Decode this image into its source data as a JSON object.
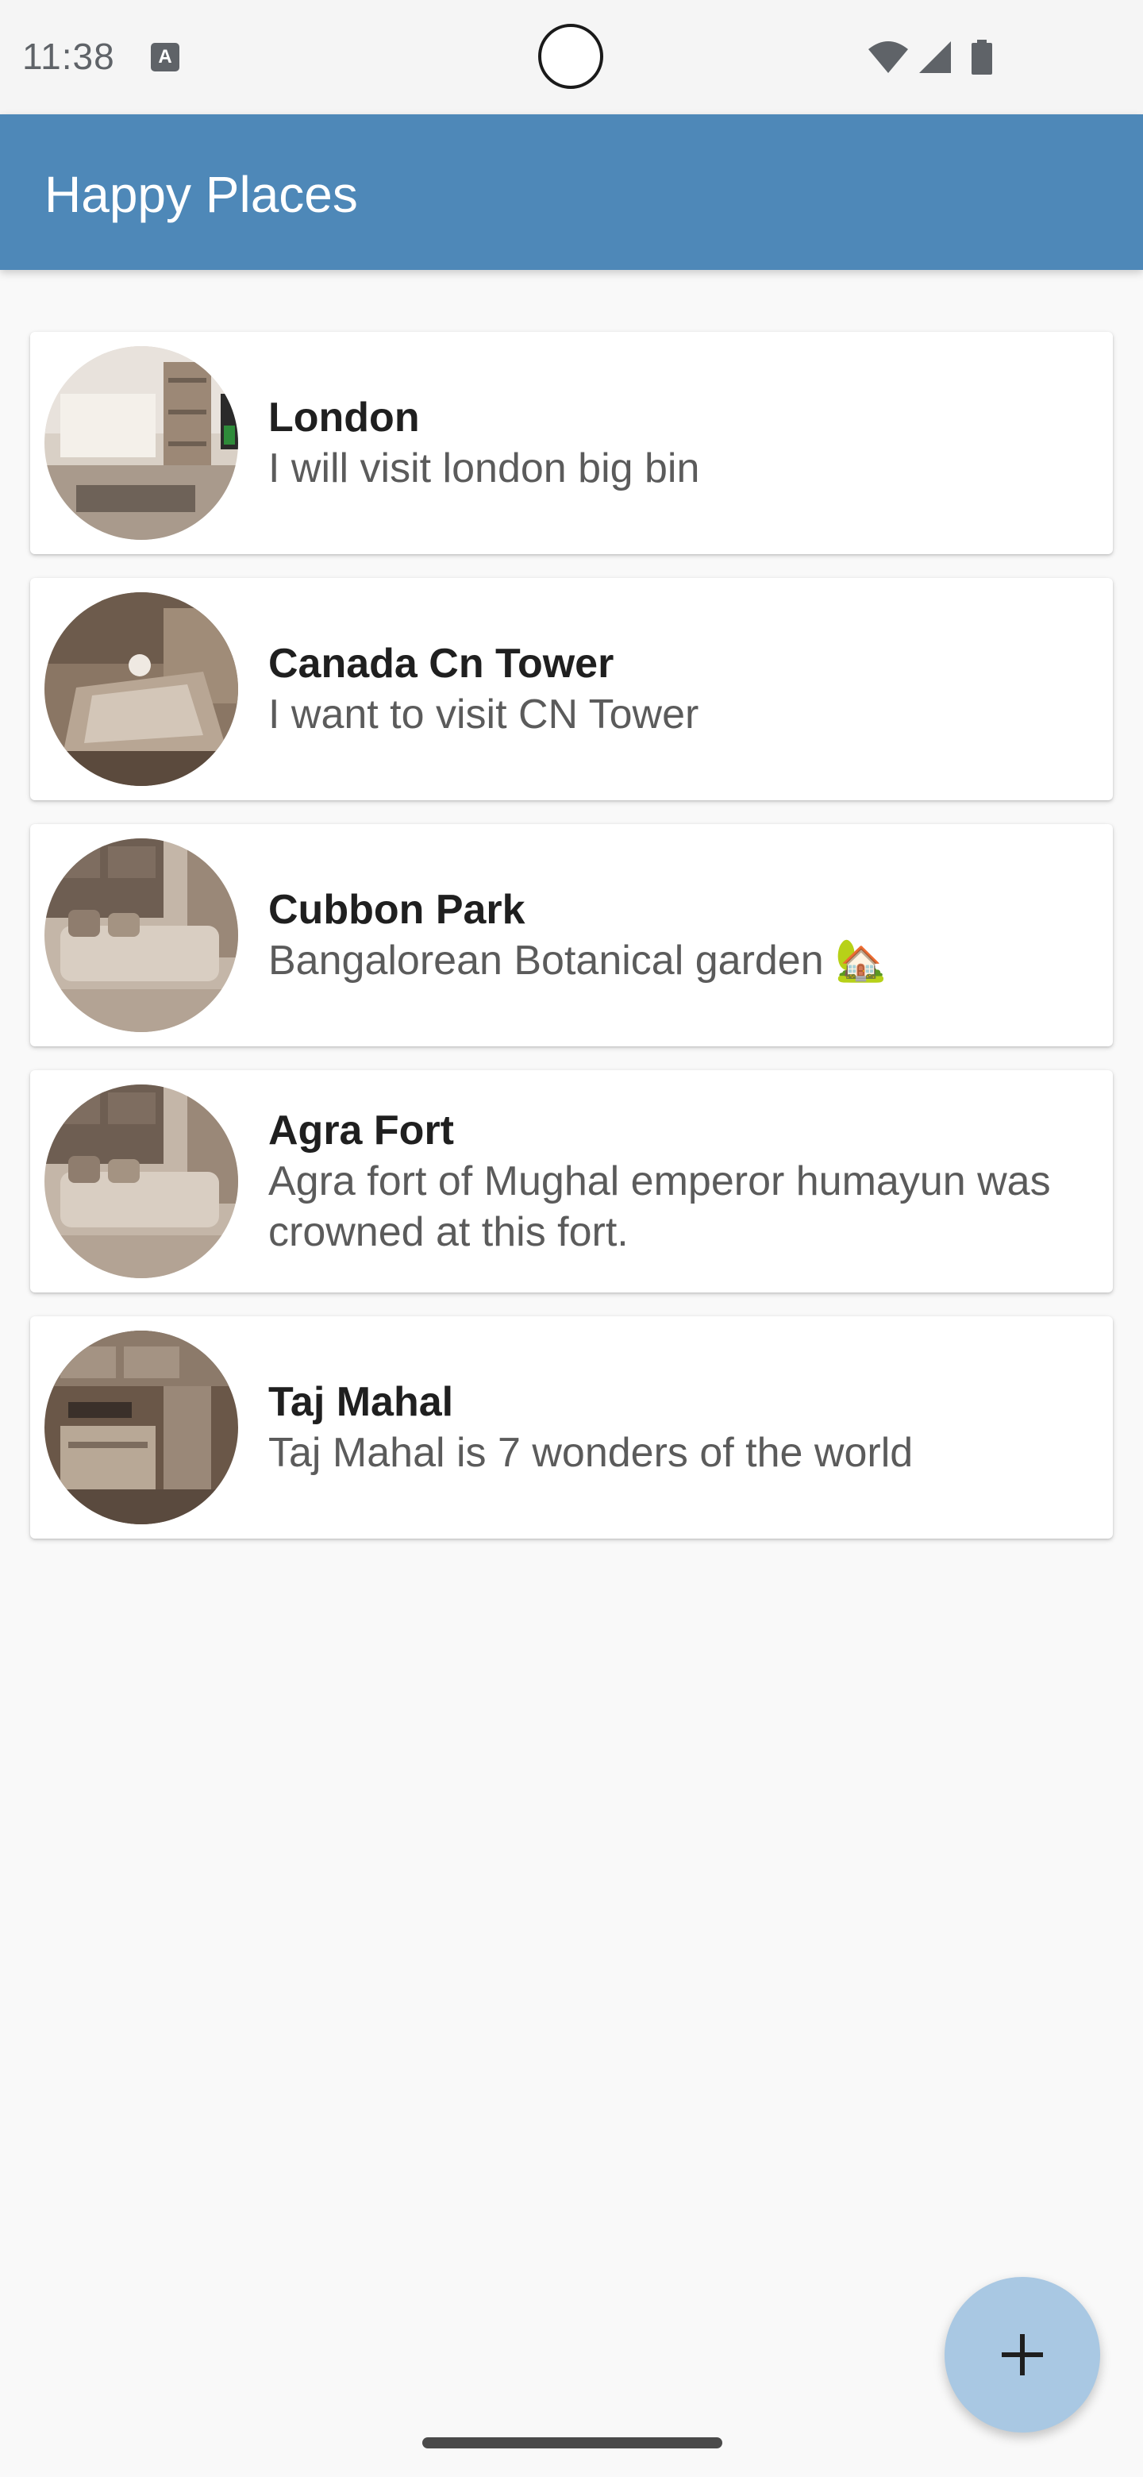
{
  "status_bar": {
    "time": "11:38",
    "keyboard_badge": "A",
    "icons": [
      "wifi-icon",
      "signal-icon",
      "battery-icon"
    ]
  },
  "app_bar": {
    "title": "Happy Places",
    "background_color": "#4e88b8"
  },
  "places": [
    {
      "title": "London",
      "description": "I will visit london big bin"
    },
    {
      "title": "Canada Cn Tower",
      "description": "I want to visit CN Tower"
    },
    {
      "title": "Cubbon Park",
      "description": "Bangalorean Botanical garden 🏡"
    },
    {
      "title": "Agra Fort",
      "description": "Agra fort of Mughal emperor humayun was crowned at this fort."
    },
    {
      "title": "Taj Mahal",
      "description": "Taj Mahal is 7 wonders of the world"
    }
  ],
  "fab": {
    "icon": "plus-icon",
    "color": "#a9c8e3"
  }
}
